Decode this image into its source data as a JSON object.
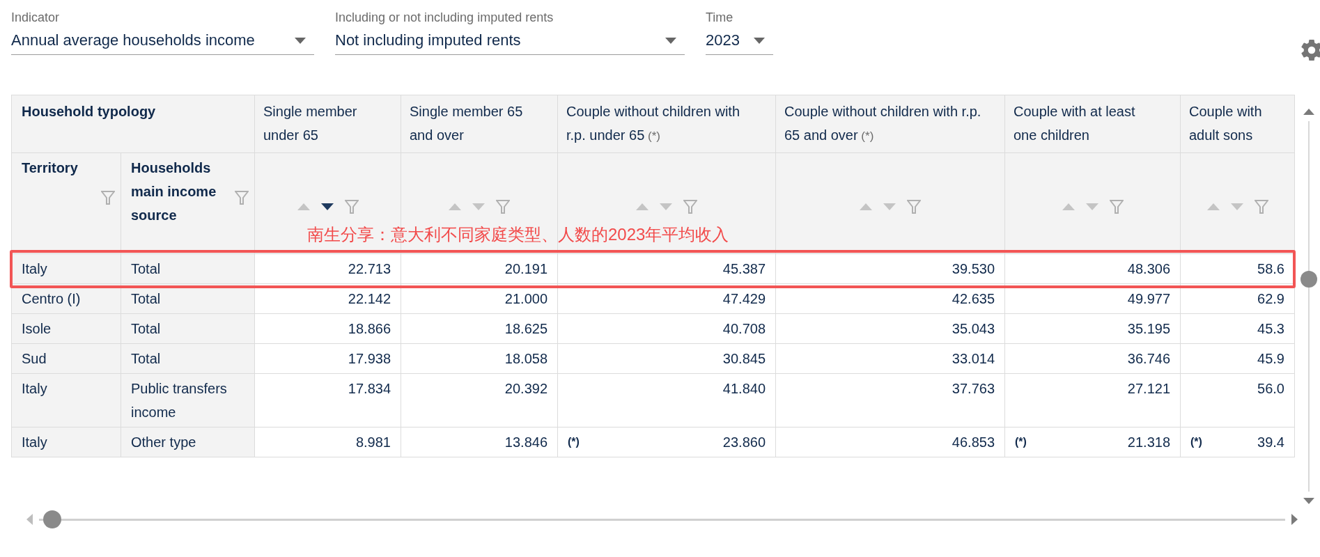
{
  "filters": [
    {
      "label": "Indicator",
      "value": "Annual average households income"
    },
    {
      "label": "Including or not including imputed rents",
      "value": "Not including imputed rents"
    },
    {
      "label": "Time",
      "value": "2023"
    }
  ],
  "table": {
    "group_header": "Household typology",
    "row_headers": [
      "Territory",
      "Households main income source"
    ],
    "columns": [
      {
        "label": "Single member under 65",
        "sorted_descending": true
      },
      {
        "label": "Single member 65 and over",
        "sorted_descending": false
      },
      {
        "label": "Couple without children with r.p. under 65",
        "note": "(*)",
        "sorted_descending": false
      },
      {
        "label": "Couple without children with r.p. 65 and over",
        "note": "(*)",
        "sorted_descending": false
      },
      {
        "label": "Couple with at least one children",
        "sorted_descending": false
      },
      {
        "label": "Couple with adult sons",
        "sorted_descending": false
      }
    ],
    "rows": [
      {
        "territory": "Italy",
        "source": "Total",
        "highlighted": true,
        "cells": [
          {
            "value": "22.713"
          },
          {
            "value": "20.191"
          },
          {
            "value": "45.387"
          },
          {
            "value": "39.530"
          },
          {
            "value": "48.306"
          },
          {
            "value": "58.6"
          }
        ]
      },
      {
        "territory": "Centro (I)",
        "source": "Total",
        "cells": [
          {
            "value": "22.142"
          },
          {
            "value": "21.000"
          },
          {
            "value": "47.429"
          },
          {
            "value": "42.635"
          },
          {
            "value": "49.977"
          },
          {
            "value": "62.9"
          }
        ]
      },
      {
        "territory": "Isole",
        "source": "Total",
        "cells": [
          {
            "value": "18.866"
          },
          {
            "value": "18.625"
          },
          {
            "value": "40.708"
          },
          {
            "value": "35.043"
          },
          {
            "value": "35.195"
          },
          {
            "value": "45.3"
          }
        ]
      },
      {
        "territory": "Sud",
        "source": "Total",
        "cells": [
          {
            "value": "17.938"
          },
          {
            "value": "18.058"
          },
          {
            "value": "30.845"
          },
          {
            "value": "33.014"
          },
          {
            "value": "36.746"
          },
          {
            "value": "45.9"
          }
        ]
      },
      {
        "territory": "Italy",
        "source": "Public transfers income",
        "cells": [
          {
            "value": "17.834"
          },
          {
            "value": "20.392"
          },
          {
            "value": "41.840"
          },
          {
            "value": "37.763"
          },
          {
            "value": "27.121"
          },
          {
            "value": "56.0"
          }
        ]
      },
      {
        "territory": "Italy",
        "source": "Other type",
        "cells": [
          {
            "value": "8.981"
          },
          {
            "value": "13.846"
          },
          {
            "flag": "(*)",
            "value": "23.860"
          },
          {
            "value": "46.853"
          },
          {
            "flag": "(*)",
            "value": "21.318"
          },
          {
            "flag": "(*)",
            "value": "39.4"
          }
        ]
      }
    ]
  },
  "annotation": {
    "text": "南生分享：意大利不同家庭类型、人数的2023年平均收入"
  }
}
